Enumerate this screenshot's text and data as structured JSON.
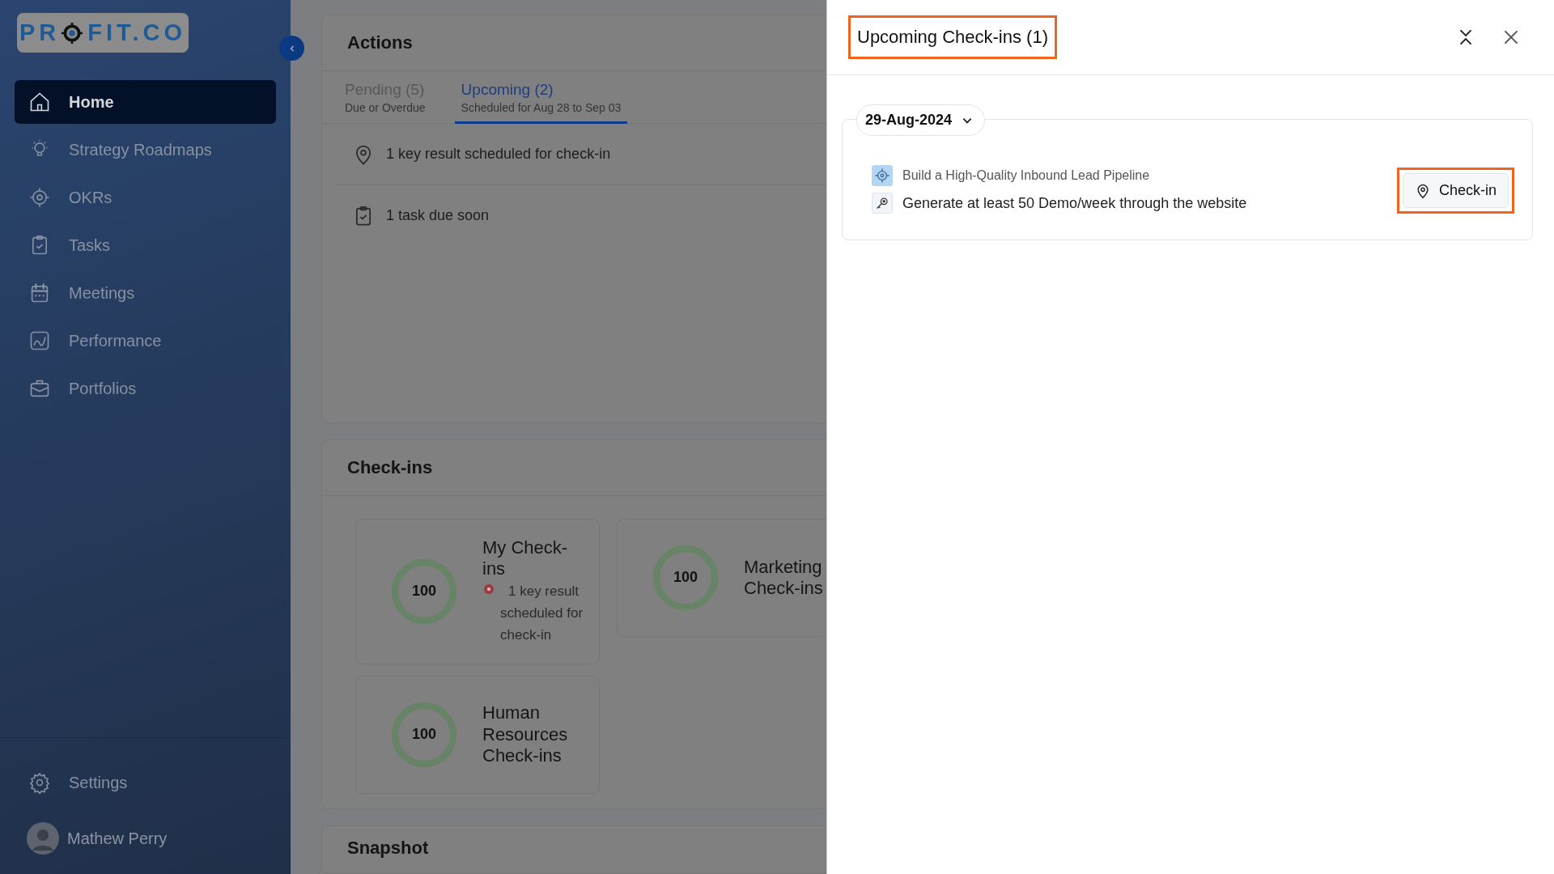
{
  "sidebar": {
    "logo": {
      "before": "PR",
      "after": "FIT.CO"
    },
    "items": [
      {
        "label": "Home",
        "selected": true
      },
      {
        "label": "Strategy Roadmaps",
        "selected": false
      },
      {
        "label": "OKRs",
        "selected": false
      },
      {
        "label": "Tasks",
        "selected": false
      },
      {
        "label": "Meetings",
        "selected": false
      },
      {
        "label": "Performance",
        "selected": false
      },
      {
        "label": "Portfolios",
        "selected": false
      }
    ],
    "settings": "Settings",
    "user": "Mathew Perry"
  },
  "actions": {
    "title": "Actions",
    "tabs": [
      {
        "label": "Pending (5)",
        "sub": "Due or Overdue",
        "selected": false
      },
      {
        "label": "Upcoming (2)",
        "sub": "Scheduled for Aug 28 to Sep 03",
        "selected": true
      }
    ],
    "rows": [
      {
        "text": "1 key result scheduled for check-in"
      },
      {
        "text": "1 task due soon"
      }
    ]
  },
  "checkins": {
    "title": "Check-ins",
    "cards": [
      {
        "score": "100",
        "level": 1,
        "title": "My Check-ins",
        "note": "1 key result scheduled for check-in"
      },
      {
        "score": "100",
        "level": 1,
        "title": "Marketing Check-ins"
      },
      {
        "score": "100",
        "level": 1,
        "title": "Human Resources Check-ins"
      }
    ]
  },
  "snapshot": {
    "title": "Snapshot"
  },
  "drawer": {
    "title": "Upcoming Check-ins (1)",
    "title_highlighted": true,
    "groups": [
      {
        "date": "29-Aug-2024",
        "expanded": true,
        "objective": "Build a High-Quality Inbound Lead Pipeline",
        "key_result": "Generate at least 50 Demo/week through the website",
        "button": "Check-in",
        "button_highlighted": true
      }
    ]
  }
}
